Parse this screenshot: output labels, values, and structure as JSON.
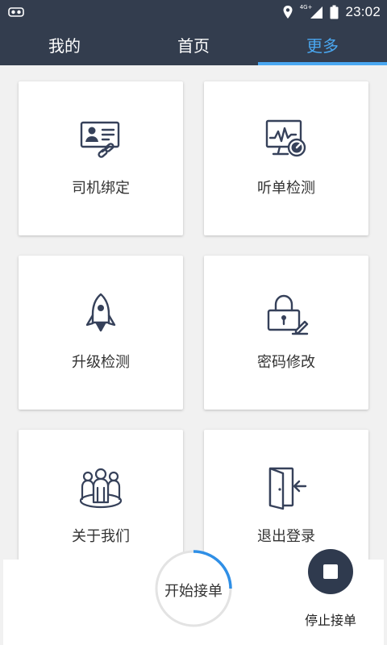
{
  "status_bar": {
    "time": "23:02",
    "network_label": "4G+",
    "icons": [
      "notification-icon",
      "location-icon",
      "signal-icon",
      "battery-icon"
    ]
  },
  "tabs": [
    {
      "label": "我的",
      "active": false
    },
    {
      "label": "首页",
      "active": false
    },
    {
      "label": "更多",
      "active": true
    }
  ],
  "cards": [
    {
      "label": "司机绑定",
      "icon": "driver-bind-icon"
    },
    {
      "label": "听单检测",
      "icon": "order-listen-check-icon"
    },
    {
      "label": "升级检测",
      "icon": "rocket-icon"
    },
    {
      "label": "密码修改",
      "icon": "lock-edit-icon"
    },
    {
      "label": "关于我们",
      "icon": "team-icon"
    },
    {
      "label": "退出登录",
      "icon": "logout-door-icon"
    }
  ],
  "bottom": {
    "start_label": "开始接单",
    "stop_label": "停止接单"
  },
  "colors": {
    "header_bg": "#333d4e",
    "accent": "#4aa7f0",
    "icon_stroke": "#36415a",
    "stop_button": "#2f3a4e"
  }
}
